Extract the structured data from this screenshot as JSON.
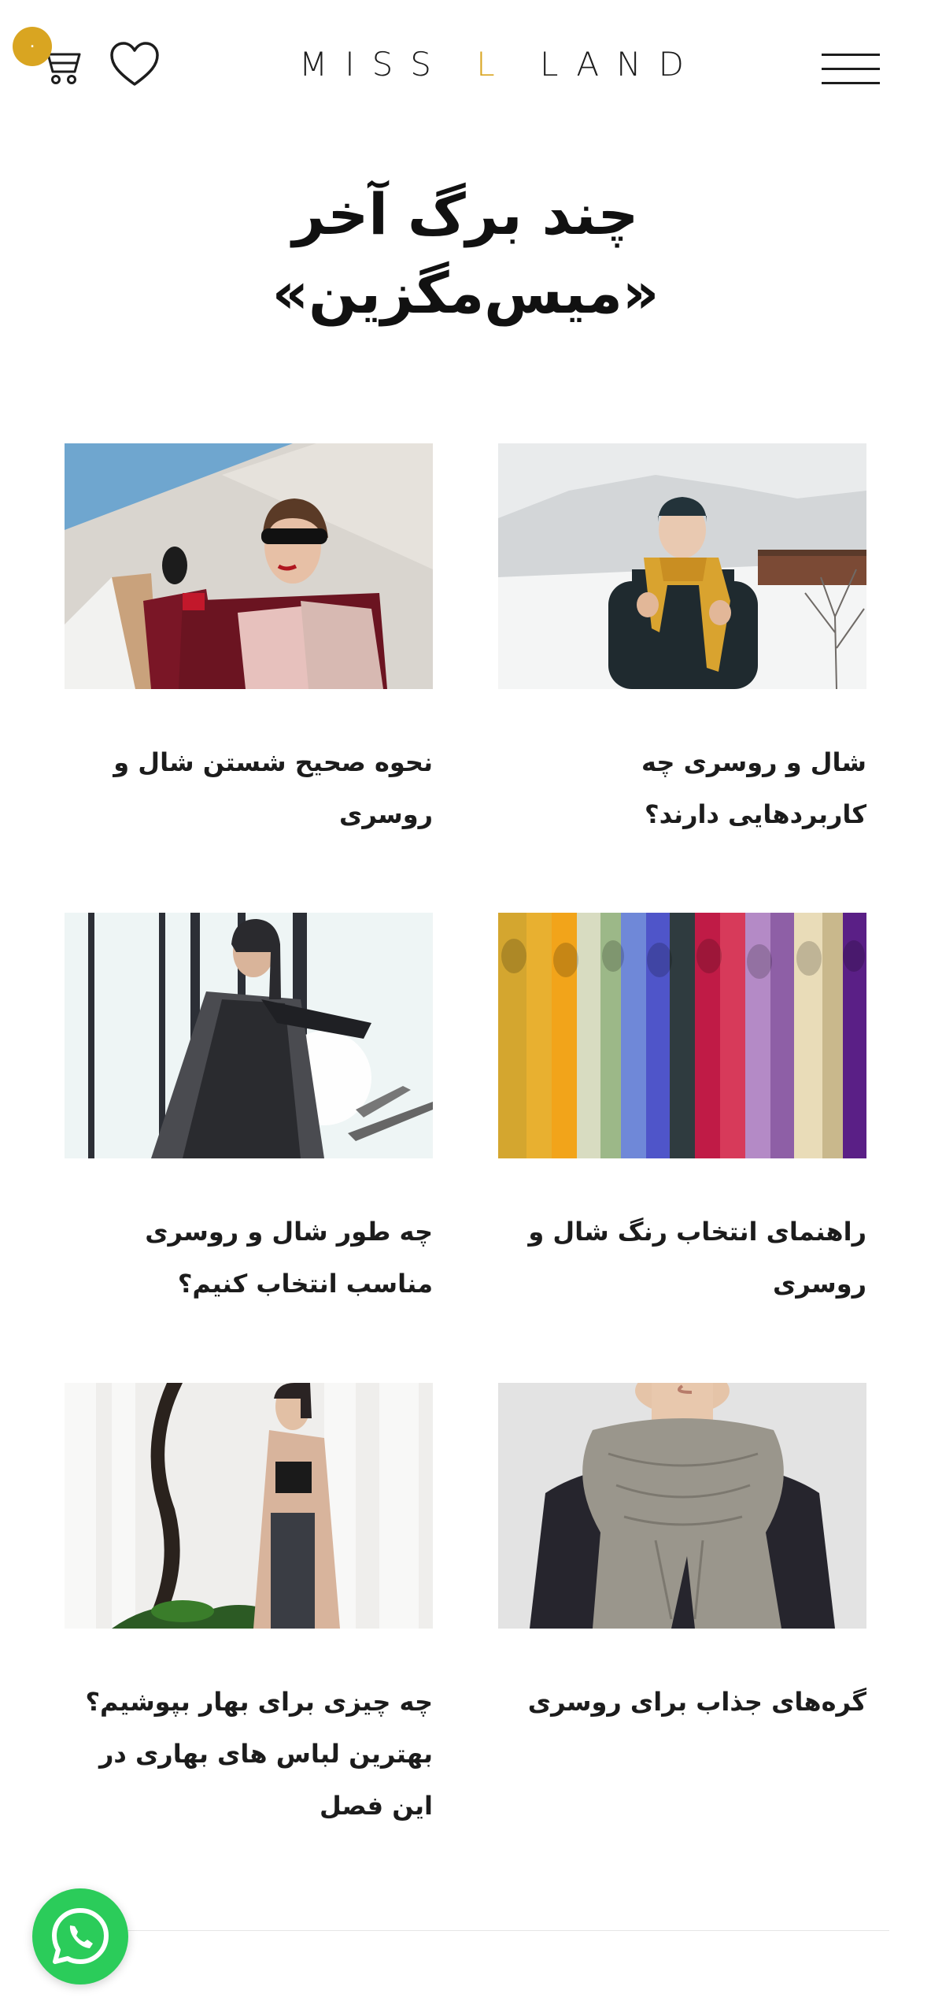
{
  "header": {
    "cart_count": "۰",
    "logo": {
      "part1": "MISS ",
      "accent": "L",
      "part2": " LAND"
    },
    "accent_color": "#d9a521",
    "icons": [
      "cart-icon",
      "heart-icon",
      "hamburger-menu-icon"
    ]
  },
  "hero": {
    "line1": "چند برگ آخر",
    "line2": "«میس‌مگزین»"
  },
  "articles": [
    {
      "title": "شال و روسری چه کاربردهایی دارند؟"
    },
    {
      "title": "نحوه صحیح شستن شال و روسری"
    },
    {
      "title": "راهنمای انتخاب رنگ شال و روسری"
    },
    {
      "title": "چه طور شال و روسری مناسب انتخاب کنیم؟"
    },
    {
      "title": "گره‌های جذاب برای روسری"
    },
    {
      "title": "چه چیزی برای بهار بپوشیم؟ بهترین لباس های بهاری در این فصل"
    }
  ],
  "floating": {
    "icon": "whatsapp-icon",
    "color": "#2bcc5a"
  }
}
